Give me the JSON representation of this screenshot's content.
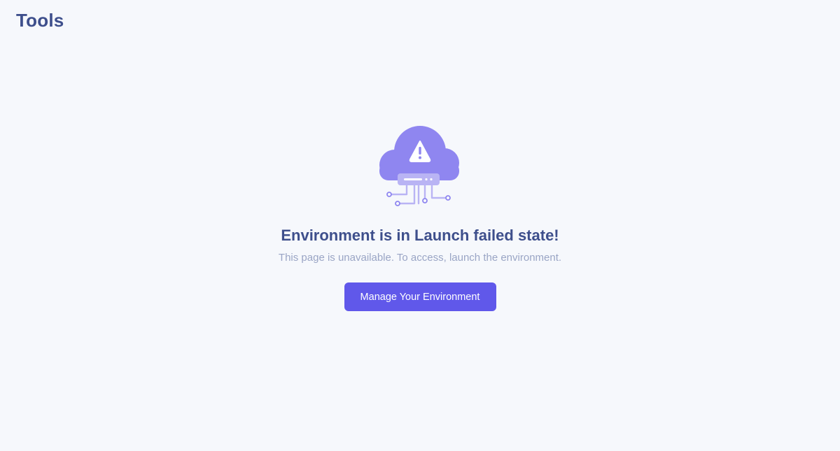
{
  "header": {
    "title": "Tools"
  },
  "empty_state": {
    "illustration_icon": "cloud-server-warning-icon",
    "heading": "Environment is in Launch failed state!",
    "message": "This page is unavailable. To access, launch the environment.",
    "button_label": "Manage Your Environment"
  },
  "colors": {
    "background": "#f6f8fc",
    "title": "#3e4f8c",
    "subtext": "#9aa5c5",
    "accent": "#6058ea",
    "cloud": "#8f86f0"
  }
}
